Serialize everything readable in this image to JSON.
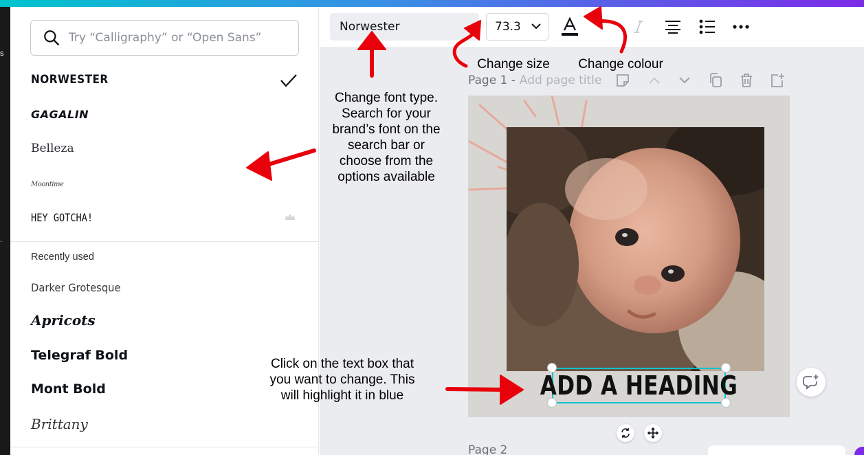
{
  "left_strip": {
    "cut_text": "s",
    "dot_text": "."
  },
  "font_panel": {
    "search_placeholder": "Try “Calligraphy” or “Open Sans”",
    "fonts": [
      {
        "label": "NORWESTER",
        "selected": true
      },
      {
        "label": "GAGALIN"
      },
      {
        "label": "Belleza"
      },
      {
        "label": "Moontime"
      },
      {
        "label": "HEY GOTCHA!",
        "premium": true
      }
    ],
    "recently_used_label": "Recently used",
    "recent_fonts": [
      {
        "label": "Darker Grotesque"
      },
      {
        "label": "Apricots"
      },
      {
        "label": "Telegraf Bold"
      },
      {
        "label": "Mont Bold"
      },
      {
        "label": "Brittany"
      }
    ]
  },
  "toolbar": {
    "font_name": "Norwester",
    "font_size": "73.3",
    "icons": [
      "text-color-icon",
      "italic-icon",
      "align-center-icon",
      "list-icon",
      "more-icon"
    ],
    "text_color": "#0e1318"
  },
  "page1": {
    "name": "Page 1 -",
    "title_placeholder": "Add page title",
    "heading_text": "ADD A HEADING"
  },
  "page2": {
    "name": "Page 2"
  },
  "annotations": {
    "change_size": "Change size",
    "change_colour": "Change colour",
    "font_type_lines": [
      "Change font type.",
      "Search for your",
      "brand’s font on the",
      "search bar or",
      "choose from the",
      "options available"
    ],
    "text_box_lines": [
      "Click on the text box that",
      "you want to change. This",
      "will highlight it in blue"
    ]
  },
  "colors": {
    "accent_teal": "#00c4cc",
    "brand_purple": "#7d2ae8",
    "arrow_red": "#e8000b",
    "canvas_background": "#d8d6d3",
    "editor_background": "#ebecf0"
  }
}
